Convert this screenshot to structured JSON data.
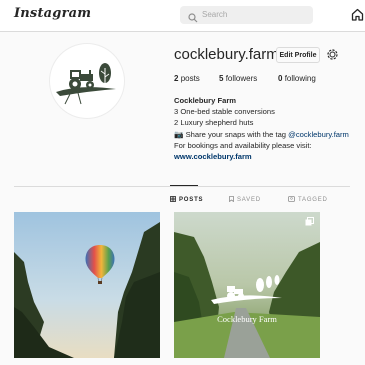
{
  "app": {
    "logo": "Instagram"
  },
  "search": {
    "placeholder": "Search"
  },
  "profile": {
    "username": "cocklebury.farm",
    "edit_label": "Edit Profile",
    "stats": [
      {
        "count": "2",
        "label": "posts"
      },
      {
        "count": "5",
        "label": "followers"
      },
      {
        "count": "0",
        "label": "following"
      }
    ],
    "bio": {
      "name": "Cocklebury Farm",
      "line1": "3 One-bed stable conversions",
      "line2": "2 Luxury shepherd huts",
      "line3_prefix": "📷 Share your snaps with the tag ",
      "line3_tag": "@cocklebury.farm",
      "line4": "For bookings and availability please visit:",
      "website": "www.cocklebury.farm"
    }
  },
  "tabs": [
    {
      "label": "POSTS",
      "icon": "grid-icon",
      "active": true
    },
    {
      "label": "SAVED",
      "icon": "bookmark-icon",
      "active": false
    },
    {
      "label": "TAGGED",
      "icon": "tagged-icon",
      "active": false
    }
  ],
  "posts": [
    {
      "type": "image",
      "subject": "hot-air-balloon"
    },
    {
      "type": "carousel",
      "caption": "Cocklebury Farm"
    }
  ],
  "colors": {
    "link": "#00376b",
    "farm_logo": "#3b4a3a",
    "border": "#dbdbdb"
  }
}
